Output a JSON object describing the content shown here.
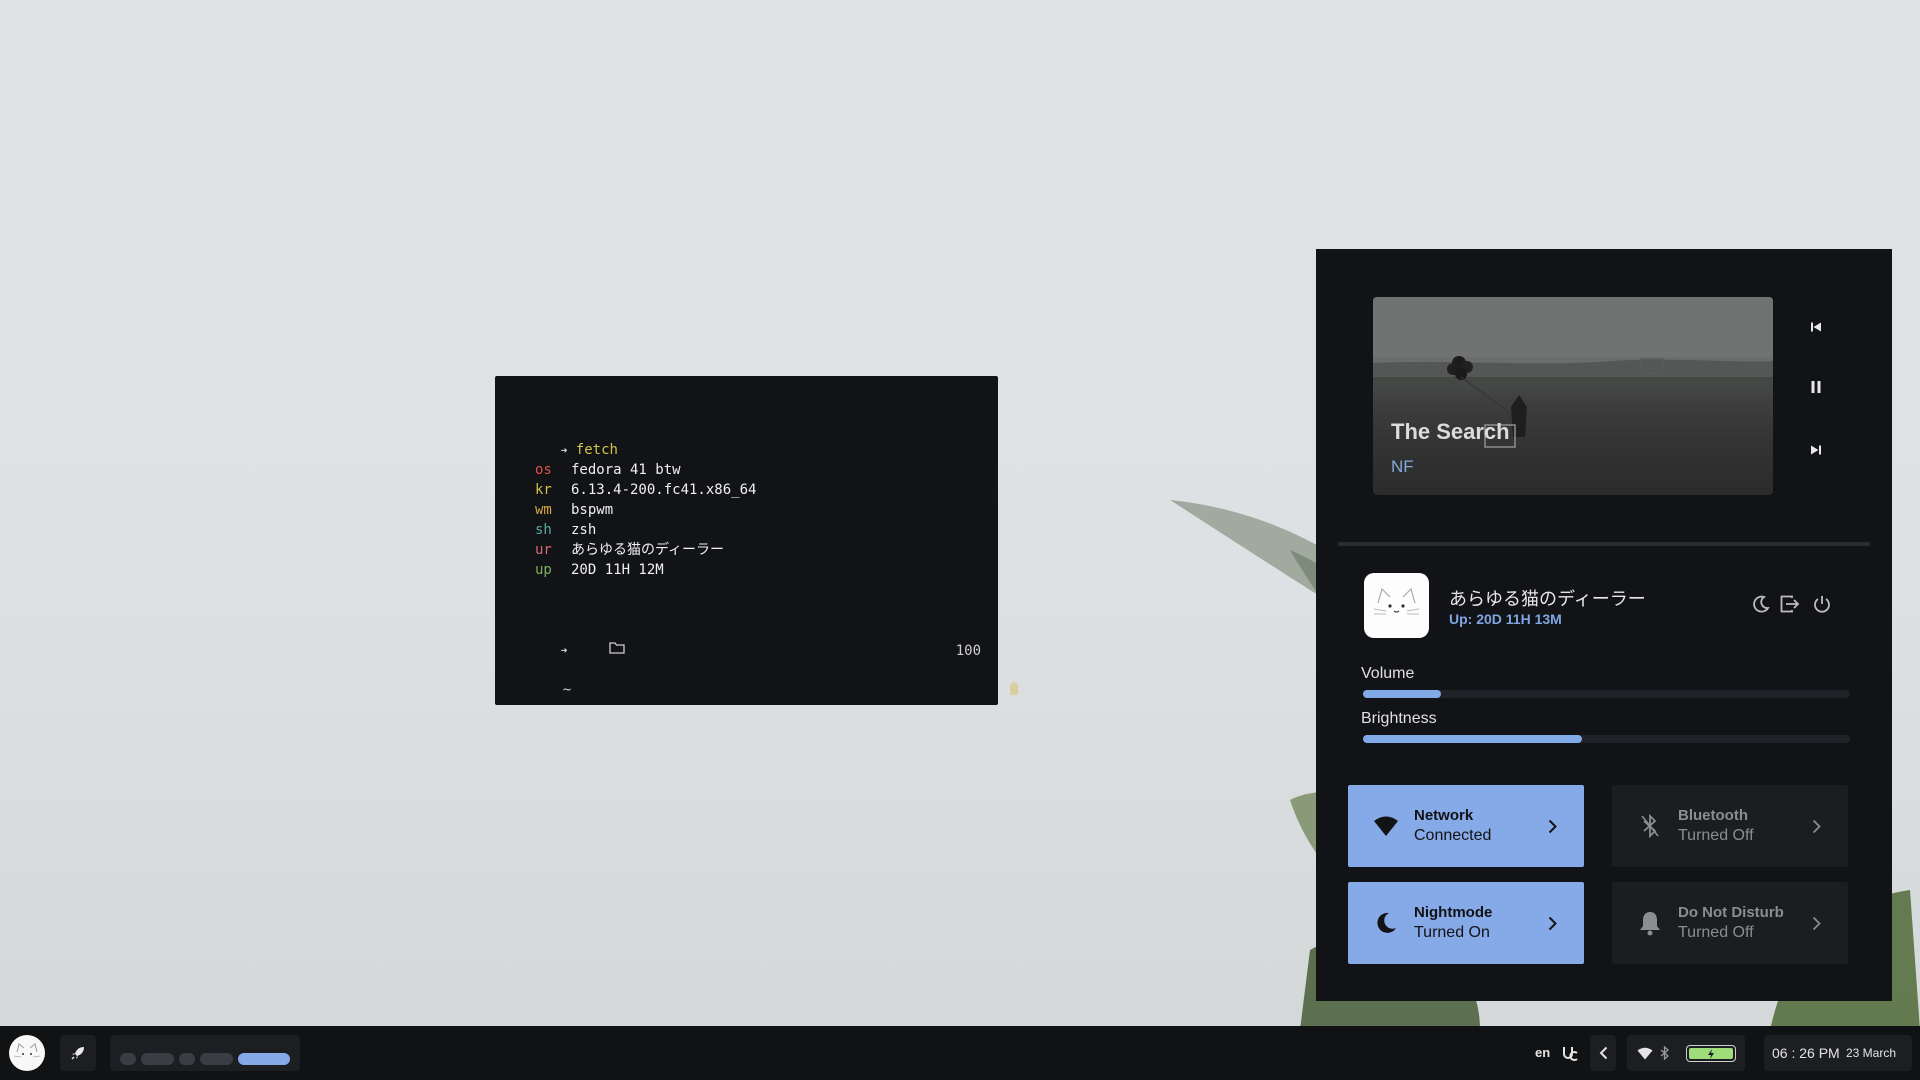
{
  "terminal": {
    "command": "fetch",
    "prompt_symbol": "➜",
    "rows": [
      {
        "key": "os",
        "value": "fedora 41 btw",
        "color": "#d9534f"
      },
      {
        "key": "kr",
        "value": "6.13.4-200.fc41.x86_64",
        "color": "#d4c047"
      },
      {
        "key": "wm",
        "value": "bspwm",
        "color": "#d4a847"
      },
      {
        "key": "sh",
        "value": "zsh",
        "color": "#5aa8a0"
      },
      {
        "key": "ur",
        "value": "あらゆる猫のディーラー",
        "color": "#d46a7a"
      },
      {
        "key": "up",
        "value": "20D 11H 12M",
        "color": "#7db05a"
      }
    ],
    "cwd": "~",
    "battery": "100"
  },
  "media": {
    "title": "The Search",
    "artist": "NF"
  },
  "user": {
    "name": "あらゆる猫のディーラー",
    "uptime": "Up: 20D 11H 13M"
  },
  "sliders": {
    "volume": {
      "label": "Volume",
      "value": 0.16
    },
    "brightness": {
      "label": "Brightness",
      "value": 0.45
    }
  },
  "tiles": {
    "network": {
      "title": "Network",
      "status": "Connected",
      "state": "on"
    },
    "bluetooth": {
      "title": "Bluetooth",
      "status": "Turned Off",
      "state": "off"
    },
    "nightmode": {
      "title": "Nightmode",
      "status": "Turned On",
      "state": "on"
    },
    "dnd": {
      "title": "Do Not Disturb",
      "status": "Turned Off",
      "state": "off"
    }
  },
  "taskbar": {
    "workspaces": 5,
    "active_workspace": 5,
    "keyboard_layout": "en",
    "time": "06 : 26 PM",
    "date": "23 March",
    "battery_charging": true
  },
  "colors": {
    "accent": "#86a9e7",
    "panel_bg": "#121316",
    "tile_off_bg": "#1b1d21"
  },
  "icons": [
    "search-icon",
    "prev-icon",
    "pause-icon",
    "next-icon",
    "moon-icon",
    "logout-icon",
    "power-icon",
    "wifi-icon",
    "bluetooth-icon",
    "bell-icon",
    "chevron-right-icon",
    "rocket-icon",
    "folder-icon",
    "battery-icon"
  ]
}
